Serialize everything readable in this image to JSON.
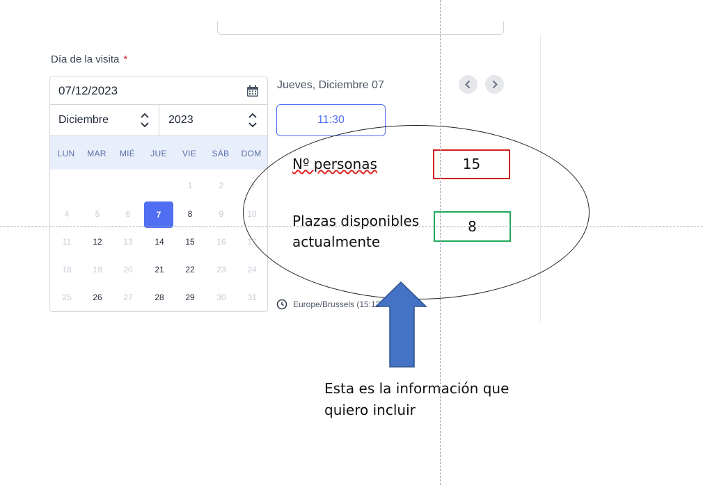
{
  "form": {
    "field_label": "Día de la visita",
    "required_mark": "*",
    "date_value": "07/12/2023",
    "month_select": "Diciembre",
    "year_select": "2023"
  },
  "calendar": {
    "weekdays": [
      "LUN",
      "MAR",
      "MIÉ",
      "JUE",
      "VIE",
      "SÁB",
      "DOM"
    ],
    "weeks": [
      [
        "",
        "",
        "",
        "",
        "1",
        "2",
        "3"
      ],
      [
        "4",
        "5",
        "6",
        "7",
        "8",
        "9",
        "10"
      ],
      [
        "11",
        "12",
        "13",
        "14",
        "15",
        "16",
        "17"
      ],
      [
        "18",
        "19",
        "20",
        "21",
        "22",
        "23",
        "24"
      ],
      [
        "25",
        "26",
        "27",
        "28",
        "29",
        "30",
        "31"
      ]
    ],
    "available_days": [
      "7",
      "8",
      "12",
      "14",
      "15",
      "21",
      "22",
      "26",
      "28",
      "29"
    ],
    "selected_day": "7"
  },
  "schedule": {
    "day_header": "Jueves, Diciembre 07",
    "time_slot": "11:30",
    "timezone": "Europe/Brussels (15:12"
  },
  "annotation": {
    "personas_label": "Nº personas",
    "personas_value": "15",
    "plazas_label": "Plazas disponibles actualmente",
    "plazas_value": "8",
    "caption": "Esta es la información que quiero incluir"
  },
  "colors": {
    "accent": "#4f6ef2",
    "required": "#dc2626",
    "annotation_red": "#d21f1f",
    "annotation_green": "#1fa85a",
    "arrow_blue": "#4472c4"
  },
  "icons": {
    "calendar": "calendar-icon",
    "select_chevrons": "chevron-up-down-icon",
    "prev": "chevron-left-icon",
    "next": "chevron-right-icon",
    "timezone": "clock-icon"
  }
}
